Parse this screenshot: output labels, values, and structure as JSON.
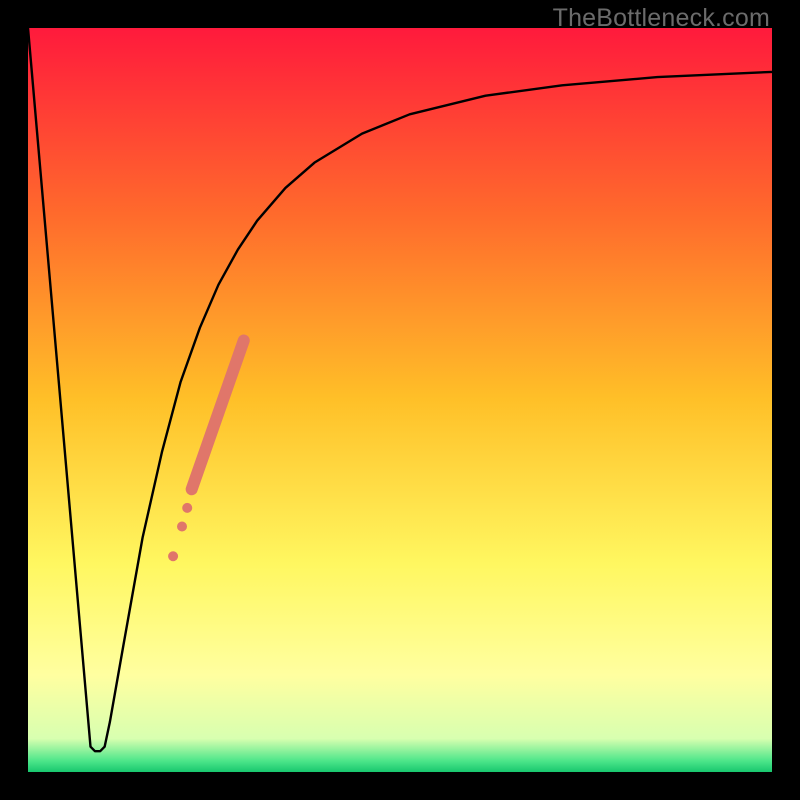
{
  "watermark": {
    "text": "TheBottleneck.com"
  },
  "chart_data": {
    "type": "line",
    "title": "",
    "xlabel": "",
    "ylabel": "",
    "xlim": [
      0,
      100
    ],
    "ylim": [
      0,
      100
    ],
    "grid": false,
    "legend": false,
    "annotations": [],
    "background_gradient": {
      "direction": "vertical",
      "stops": [
        {
          "pos": 0.0,
          "color": "#ff1a3c"
        },
        {
          "pos": 0.25,
          "color": "#ff6a2c"
        },
        {
          "pos": 0.5,
          "color": "#ffc028"
        },
        {
          "pos": 0.72,
          "color": "#fff760"
        },
        {
          "pos": 0.87,
          "color": "#ffffa0"
        },
        {
          "pos": 0.955,
          "color": "#d8ffb0"
        },
        {
          "pos": 0.985,
          "color": "#4de68a"
        },
        {
          "pos": 1.0,
          "color": "#18c76e"
        }
      ]
    },
    "series": [
      {
        "name": "bottleneck-curve",
        "type": "line",
        "color": "#000000",
        "x": [
          0.0,
          8.4,
          9.0,
          9.7,
          10.3,
          11.0,
          12.8,
          15.4,
          18.0,
          20.5,
          23.1,
          25.6,
          28.2,
          30.8,
          34.6,
          38.5,
          44.9,
          51.3,
          61.5,
          71.8,
          84.6,
          100.0
        ],
        "y": [
          100.0,
          3.4,
          2.8,
          2.8,
          3.4,
          6.7,
          16.9,
          31.5,
          43.0,
          52.4,
          59.7,
          65.5,
          70.2,
          74.1,
          78.5,
          81.9,
          85.8,
          88.4,
          90.9,
          92.3,
          93.4,
          94.1
        ]
      },
      {
        "name": "highlight-segment",
        "type": "line",
        "color": "#e0766a",
        "stroke_width": 12,
        "x": [
          22.0,
          29.0
        ],
        "y": [
          38.0,
          58.0
        ]
      },
      {
        "name": "highlight-dots",
        "type": "scatter",
        "color": "#e0766a",
        "marker_size": 10,
        "x": [
          19.5,
          20.7,
          21.4
        ],
        "y": [
          29.0,
          33.0,
          35.5
        ]
      }
    ]
  }
}
